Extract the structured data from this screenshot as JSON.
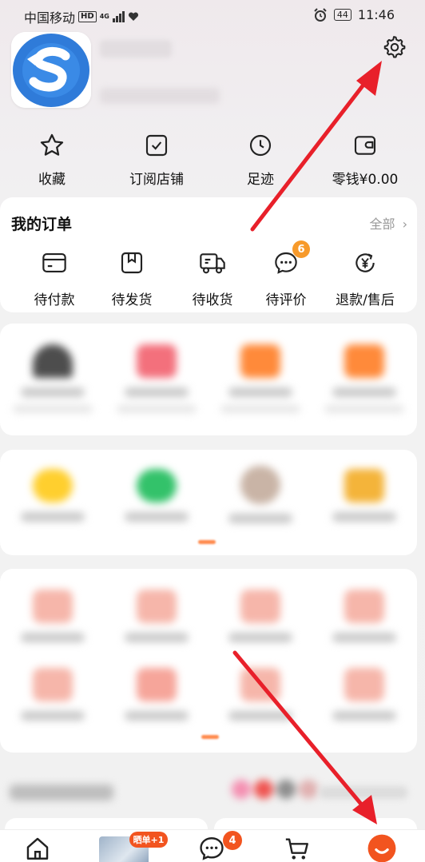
{
  "status_bar": {
    "carrier": "中国移动",
    "hd": "HD",
    "network": "4G",
    "battery": "44",
    "time": "11:46"
  },
  "quick_links": [
    {
      "label": "收藏",
      "icon": "star-icon"
    },
    {
      "label": "订阅店铺",
      "icon": "check-square-icon"
    },
    {
      "label": "足迹",
      "icon": "clock-icon"
    },
    {
      "label": "零钱¥0.00",
      "icon": "wallet-icon"
    }
  ],
  "orders": {
    "title": "我的订单",
    "view_all": "全部",
    "items": [
      {
        "label": "待付款",
        "icon": "card-icon"
      },
      {
        "label": "待发货",
        "icon": "package-icon"
      },
      {
        "label": "待收货",
        "icon": "truck-icon"
      },
      {
        "label": "待评价",
        "icon": "chat-dots-icon",
        "badge": "6"
      },
      {
        "label": "退款/售后",
        "icon": "refund-icon"
      }
    ]
  },
  "bottom_nav": {
    "share_badge": "晒单+1",
    "message_badge": "4"
  },
  "colors": {
    "accent": "#f2541f",
    "badge": "#f79a2b",
    "arrow": "#e8202a",
    "logo_blue": "#2f7bd9"
  }
}
